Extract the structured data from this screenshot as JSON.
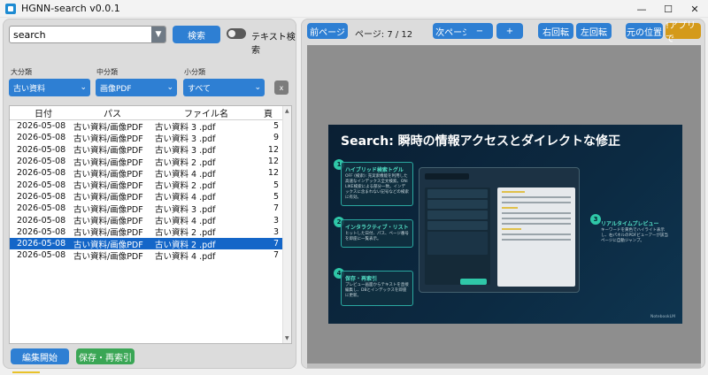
{
  "window": {
    "title": "HGNN-search v0.0.1",
    "minimize": "—",
    "maximize": "☐",
    "close": "✕"
  },
  "search": {
    "value": "search",
    "button": "検索",
    "text_search_label": "テキスト検索"
  },
  "filters": {
    "major": {
      "label": "大分類",
      "value": "古い資料"
    },
    "middle": {
      "label": "中分類",
      "value": "画像PDF"
    },
    "minor": {
      "label": "小分類",
      "value": "すべて"
    },
    "clear": "x"
  },
  "table": {
    "headers": [
      "日付",
      "パス",
      "ファイル名",
      "頁"
    ],
    "rows": [
      [
        "2026-05-08",
        "古い資料/画像PDF",
        "古い資料 3 .pdf",
        "5"
      ],
      [
        "2026-05-08",
        "古い資料/画像PDF",
        "古い資料 3 .pdf",
        "9"
      ],
      [
        "2026-05-08",
        "古い資料/画像PDF",
        "古い資料 3 .pdf",
        "12"
      ],
      [
        "2026-05-08",
        "古い資料/画像PDF",
        "古い資料 2 .pdf",
        "12"
      ],
      [
        "2026-05-08",
        "古い資料/画像PDF",
        "古い資料 4 .pdf",
        "12"
      ],
      [
        "2026-05-08",
        "古い資料/画像PDF",
        "古い資料 2 .pdf",
        "5"
      ],
      [
        "2026-05-08",
        "古い資料/画像PDF",
        "古い資料 4 .pdf",
        "5"
      ],
      [
        "2026-05-08",
        "古い資料/画像PDF",
        "古い資料 3 .pdf",
        "7"
      ],
      [
        "2026-05-08",
        "古い資料/画像PDF",
        "古い資料 4 .pdf",
        "3"
      ],
      [
        "2026-05-08",
        "古い資料/画像PDF",
        "古い資料 2 .pdf",
        "3"
      ],
      [
        "2026-05-08",
        "古い資料/画像PDF",
        "古い資料 2 .pdf",
        "7"
      ],
      [
        "2026-05-08",
        "古い資料/画像PDF",
        "古い資料 4 .pdf",
        "7"
      ]
    ],
    "selected_index": 10
  },
  "bottom": {
    "edit_button": "編集開始",
    "save_button": "保存・再索引"
  },
  "viewer": {
    "prev": "前ページ",
    "page": "ページ: 7 / 12",
    "next": "次ページ",
    "zoom_out": "−",
    "zoom_in": "+",
    "rotate_right": "右回転",
    "rotate_left": "左回転",
    "reset": "元の位置",
    "open_app": "!アプリで"
  },
  "slide": {
    "title": "Search: 瞬時の情報アクセスとダイレクトな修正",
    "steps": [
      {
        "num": "1",
        "title": "ハイブリッド検索トグル",
        "desc": "OFF (検索): 充実索機能を利用した高速なインデックス全文検索。ON: LIKE検索による部分一致。インデックスに含まれない記号などの検索に有効。"
      },
      {
        "num": "2",
        "title": "インタラクティブ・リスト",
        "desc": "ヒットした日付、パス、ページ番号を即座に一覧表示。"
      },
      {
        "num": "3",
        "title": "リアルタイムプレビュー",
        "desc": "キーワードを黄色でハイライト表示し、右パネルのPDFビューアーが該当ページに自動ジャンプ。"
      },
      {
        "num": "4",
        "title": "保存・再索引",
        "desc": "プレビュー画面からテキストを直接編集し、DBとインデックスを即座に更新。"
      }
    ],
    "watermark": "NotebookLM"
  },
  "colors": {
    "accent": "#2e7fd3",
    "selection": "#1466c8",
    "save": "#3aa655",
    "open_app": "#d49a1a"
  },
  "progress": {
    "fraction": 0.1
  }
}
